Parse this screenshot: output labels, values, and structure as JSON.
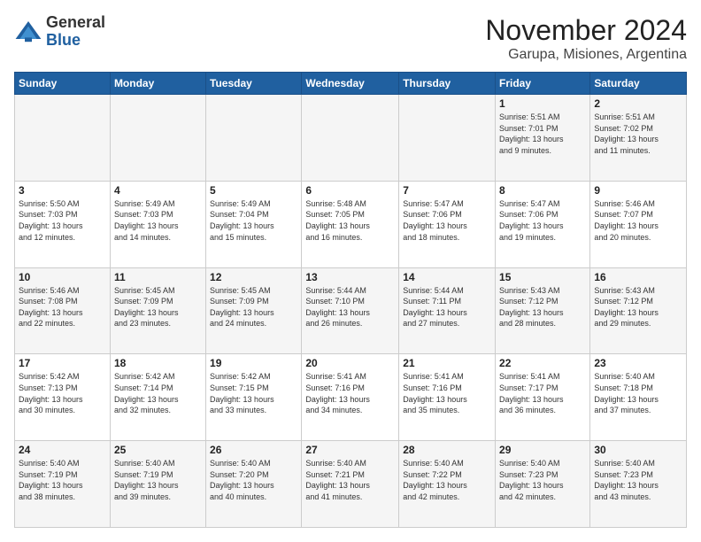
{
  "logo": {
    "general": "General",
    "blue": "Blue"
  },
  "title": "November 2024",
  "subtitle": "Garupa, Misiones, Argentina",
  "days_of_week": [
    "Sunday",
    "Monday",
    "Tuesday",
    "Wednesday",
    "Thursday",
    "Friday",
    "Saturday"
  ],
  "weeks": [
    [
      {
        "day": "",
        "info": ""
      },
      {
        "day": "",
        "info": ""
      },
      {
        "day": "",
        "info": ""
      },
      {
        "day": "",
        "info": ""
      },
      {
        "day": "",
        "info": ""
      },
      {
        "day": "1",
        "info": "Sunrise: 5:51 AM\nSunset: 7:01 PM\nDaylight: 13 hours\nand 9 minutes."
      },
      {
        "day": "2",
        "info": "Sunrise: 5:51 AM\nSunset: 7:02 PM\nDaylight: 13 hours\nand 11 minutes."
      }
    ],
    [
      {
        "day": "3",
        "info": "Sunrise: 5:50 AM\nSunset: 7:03 PM\nDaylight: 13 hours\nand 12 minutes."
      },
      {
        "day": "4",
        "info": "Sunrise: 5:49 AM\nSunset: 7:03 PM\nDaylight: 13 hours\nand 14 minutes."
      },
      {
        "day": "5",
        "info": "Sunrise: 5:49 AM\nSunset: 7:04 PM\nDaylight: 13 hours\nand 15 minutes."
      },
      {
        "day": "6",
        "info": "Sunrise: 5:48 AM\nSunset: 7:05 PM\nDaylight: 13 hours\nand 16 minutes."
      },
      {
        "day": "7",
        "info": "Sunrise: 5:47 AM\nSunset: 7:06 PM\nDaylight: 13 hours\nand 18 minutes."
      },
      {
        "day": "8",
        "info": "Sunrise: 5:47 AM\nSunset: 7:06 PM\nDaylight: 13 hours\nand 19 minutes."
      },
      {
        "day": "9",
        "info": "Sunrise: 5:46 AM\nSunset: 7:07 PM\nDaylight: 13 hours\nand 20 minutes."
      }
    ],
    [
      {
        "day": "10",
        "info": "Sunrise: 5:46 AM\nSunset: 7:08 PM\nDaylight: 13 hours\nand 22 minutes."
      },
      {
        "day": "11",
        "info": "Sunrise: 5:45 AM\nSunset: 7:09 PM\nDaylight: 13 hours\nand 23 minutes."
      },
      {
        "day": "12",
        "info": "Sunrise: 5:45 AM\nSunset: 7:09 PM\nDaylight: 13 hours\nand 24 minutes."
      },
      {
        "day": "13",
        "info": "Sunrise: 5:44 AM\nSunset: 7:10 PM\nDaylight: 13 hours\nand 26 minutes."
      },
      {
        "day": "14",
        "info": "Sunrise: 5:44 AM\nSunset: 7:11 PM\nDaylight: 13 hours\nand 27 minutes."
      },
      {
        "day": "15",
        "info": "Sunrise: 5:43 AM\nSunset: 7:12 PM\nDaylight: 13 hours\nand 28 minutes."
      },
      {
        "day": "16",
        "info": "Sunrise: 5:43 AM\nSunset: 7:12 PM\nDaylight: 13 hours\nand 29 minutes."
      }
    ],
    [
      {
        "day": "17",
        "info": "Sunrise: 5:42 AM\nSunset: 7:13 PM\nDaylight: 13 hours\nand 30 minutes."
      },
      {
        "day": "18",
        "info": "Sunrise: 5:42 AM\nSunset: 7:14 PM\nDaylight: 13 hours\nand 32 minutes."
      },
      {
        "day": "19",
        "info": "Sunrise: 5:42 AM\nSunset: 7:15 PM\nDaylight: 13 hours\nand 33 minutes."
      },
      {
        "day": "20",
        "info": "Sunrise: 5:41 AM\nSunset: 7:16 PM\nDaylight: 13 hours\nand 34 minutes."
      },
      {
        "day": "21",
        "info": "Sunrise: 5:41 AM\nSunset: 7:16 PM\nDaylight: 13 hours\nand 35 minutes."
      },
      {
        "day": "22",
        "info": "Sunrise: 5:41 AM\nSunset: 7:17 PM\nDaylight: 13 hours\nand 36 minutes."
      },
      {
        "day": "23",
        "info": "Sunrise: 5:40 AM\nSunset: 7:18 PM\nDaylight: 13 hours\nand 37 minutes."
      }
    ],
    [
      {
        "day": "24",
        "info": "Sunrise: 5:40 AM\nSunset: 7:19 PM\nDaylight: 13 hours\nand 38 minutes."
      },
      {
        "day": "25",
        "info": "Sunrise: 5:40 AM\nSunset: 7:19 PM\nDaylight: 13 hours\nand 39 minutes."
      },
      {
        "day": "26",
        "info": "Sunrise: 5:40 AM\nSunset: 7:20 PM\nDaylight: 13 hours\nand 40 minutes."
      },
      {
        "day": "27",
        "info": "Sunrise: 5:40 AM\nSunset: 7:21 PM\nDaylight: 13 hours\nand 41 minutes."
      },
      {
        "day": "28",
        "info": "Sunrise: 5:40 AM\nSunset: 7:22 PM\nDaylight: 13 hours\nand 42 minutes."
      },
      {
        "day": "29",
        "info": "Sunrise: 5:40 AM\nSunset: 7:23 PM\nDaylight: 13 hours\nand 42 minutes."
      },
      {
        "day": "30",
        "info": "Sunrise: 5:40 AM\nSunset: 7:23 PM\nDaylight: 13 hours\nand 43 minutes."
      }
    ]
  ]
}
